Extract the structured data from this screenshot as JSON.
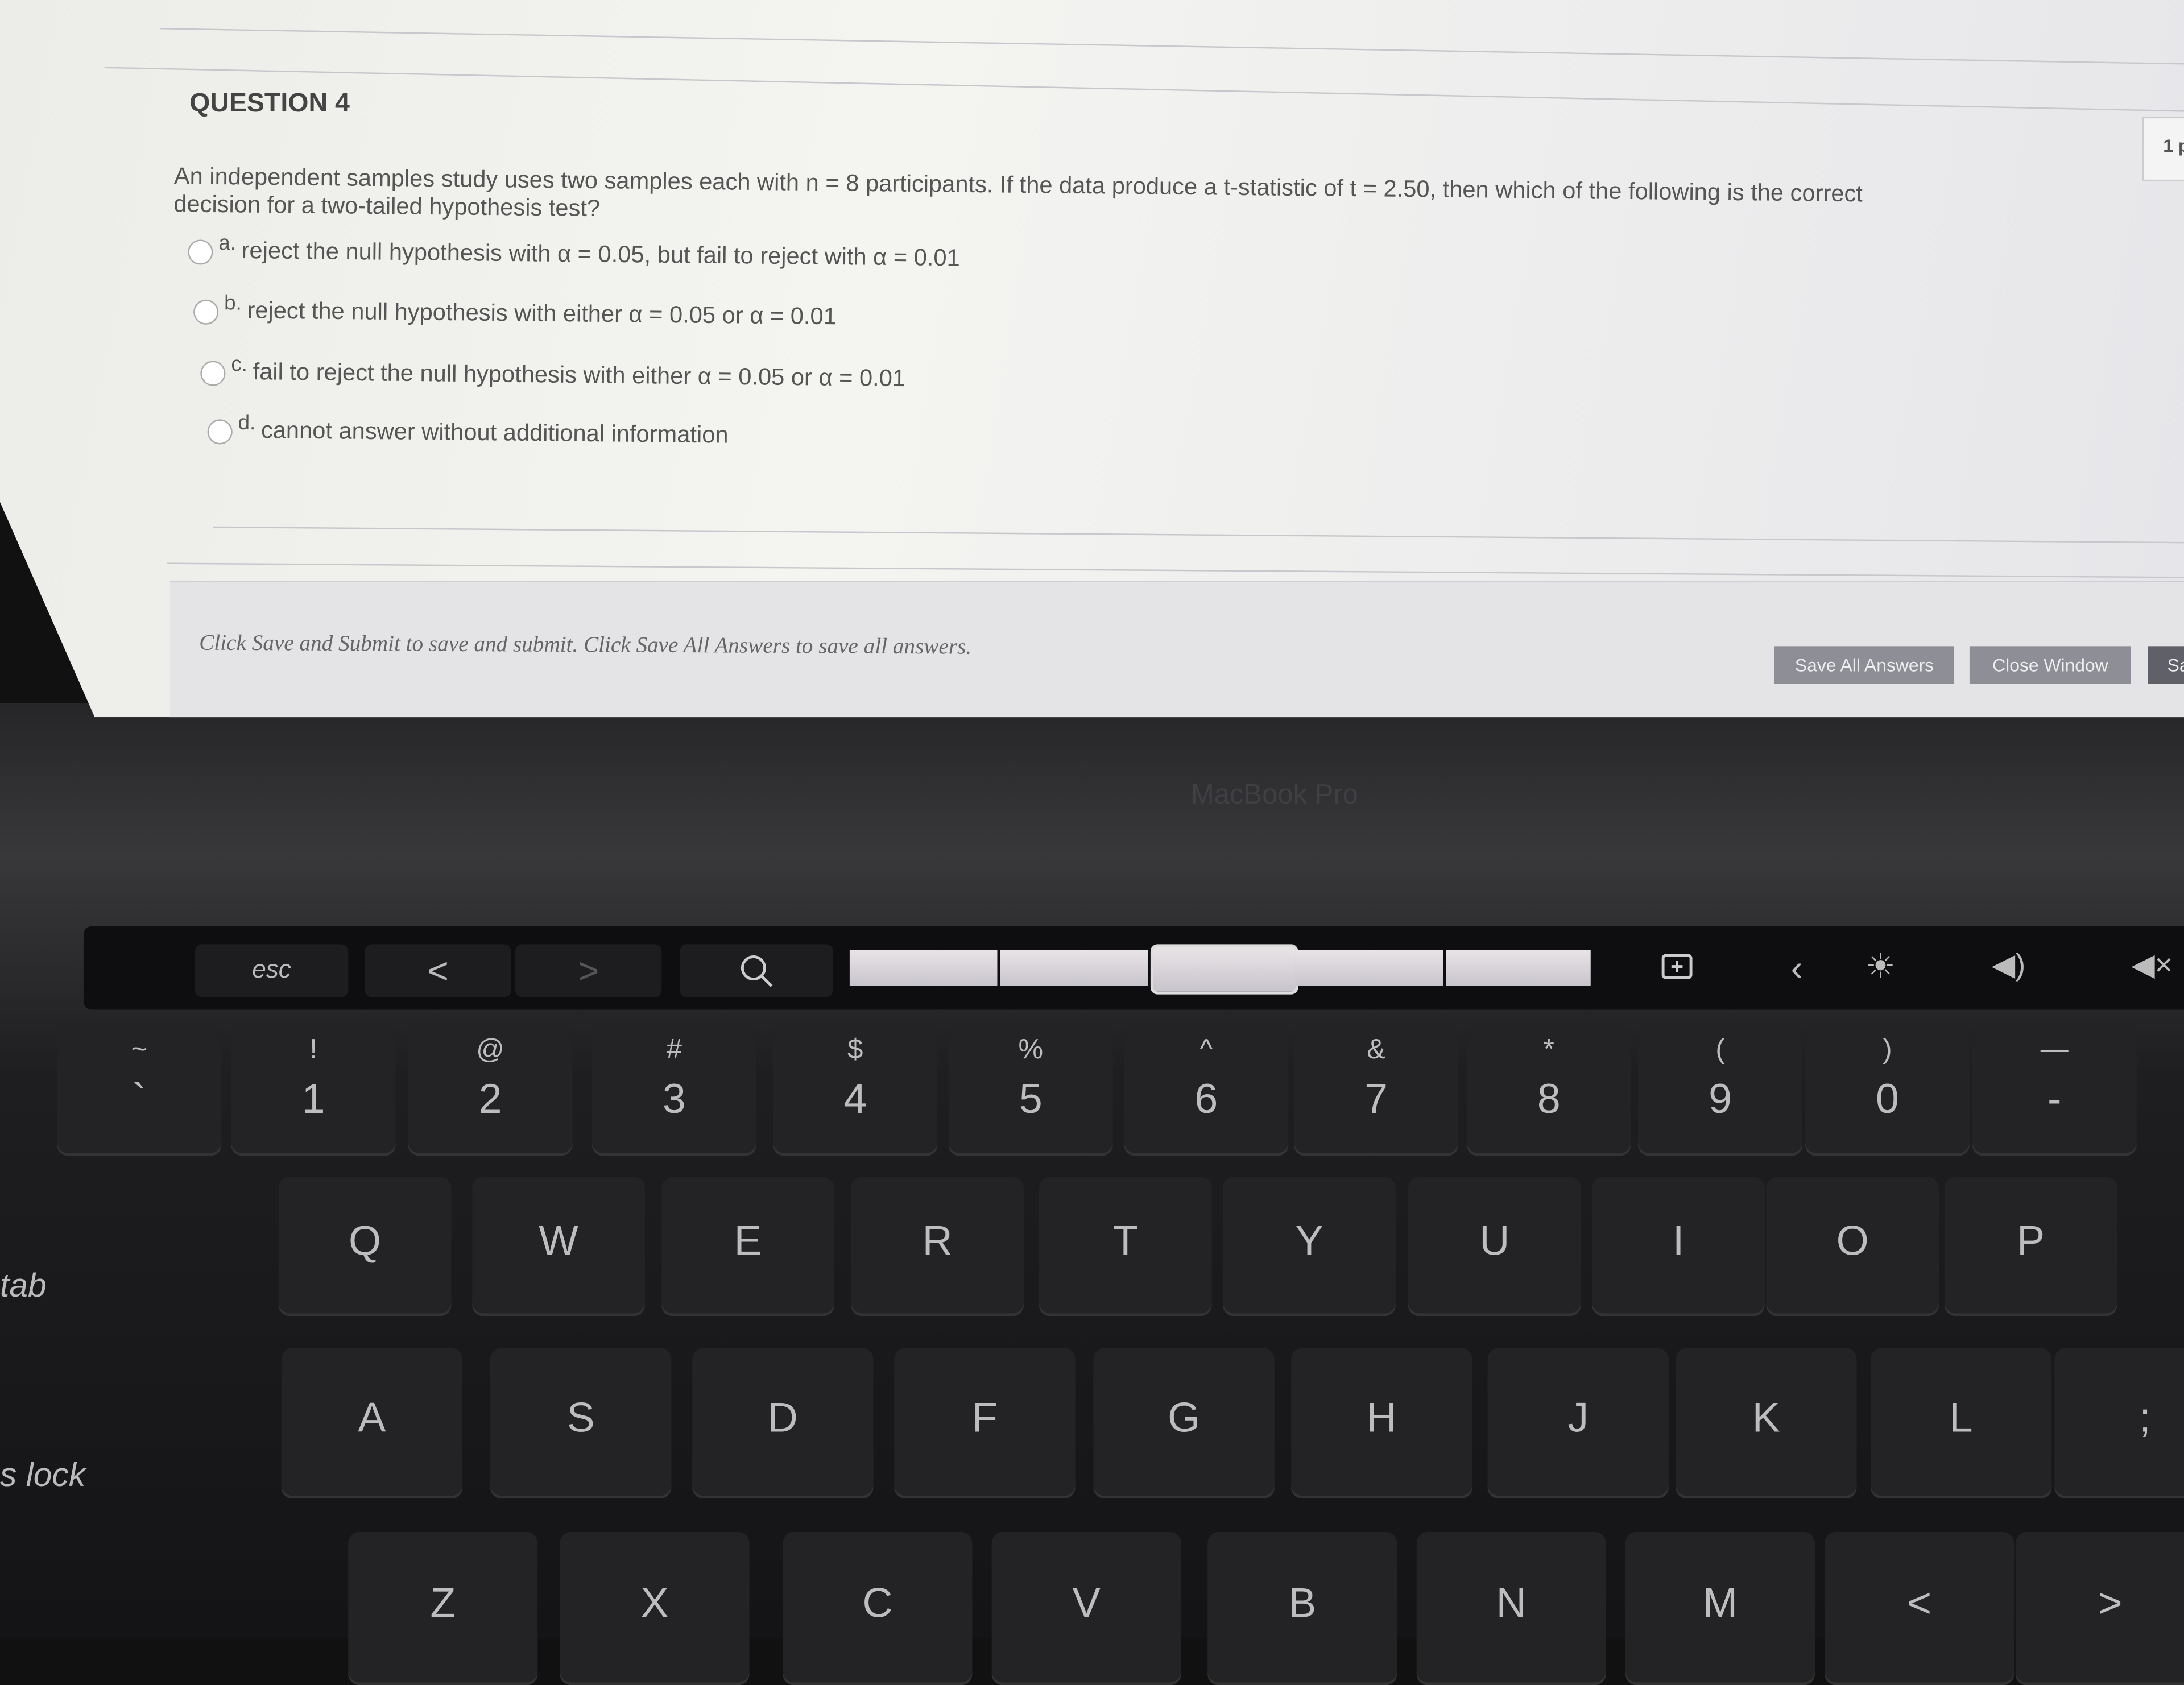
{
  "question": {
    "title": "QUESTION 4",
    "points": "1 p",
    "text": "An independent samples study uses two samples each with n = 8 participants. If the data produce a t-statistic of t = 2.50, then which of the following is the correct decision for a two-tailed hypothesis test?",
    "options": [
      {
        "letter": "a.",
        "text": "reject the null hypothesis with α = 0.05, but fail to reject with α = 0.01",
        "selected": false
      },
      {
        "letter": "b.",
        "text": "reject the null hypothesis with either α = 0.05 or α = 0.01",
        "selected": false
      },
      {
        "letter": "c.",
        "text": "fail to reject the null hypothesis with either α = 0.05 or α = 0.01",
        "selected": false
      },
      {
        "letter": "d.",
        "text": "cannot answer without additional information",
        "selected": false
      }
    ]
  },
  "footer": {
    "hint": "Click Save and Submit to save and submit. Click Save All Answers to save all answers.",
    "save_all": "Save All Answers",
    "close_window": "Close Window",
    "save_submit_partial": "Sa"
  },
  "laptop": {
    "brand": "MacBook Pro"
  },
  "touchbar": {
    "esc": "esc",
    "back": "<",
    "forward": ">",
    "icons": [
      "search-icon",
      "tab-thumbnails",
      "add-tab-icon",
      "collapse-chevron-icon",
      "brightness-icon",
      "volume-icon",
      "mute-icon"
    ]
  },
  "keyboard": {
    "number_row": [
      [
        "~",
        "`"
      ],
      [
        "!",
        "1"
      ],
      [
        "@",
        "2"
      ],
      [
        "#",
        "3"
      ],
      [
        "$",
        "4"
      ],
      [
        "%",
        "5"
      ],
      [
        "^",
        "6"
      ],
      [
        "&",
        "7"
      ],
      [
        "*",
        "8"
      ],
      [
        "(",
        "9"
      ],
      [
        ")",
        "0"
      ],
      [
        "—",
        "-"
      ]
    ],
    "qwerty_row": [
      "Q",
      "W",
      "E",
      "R",
      "T",
      "Y",
      "U",
      "I",
      "O",
      "P"
    ],
    "home_row": [
      "A",
      "S",
      "D",
      "F",
      "G",
      "H",
      "J",
      "K",
      "L",
      ";"
    ],
    "bottom_row": [
      "Z",
      "X",
      "C",
      "V",
      "B",
      "N",
      "M",
      "<",
      ">"
    ],
    "tab": "tab",
    "caps": "s lock"
  }
}
